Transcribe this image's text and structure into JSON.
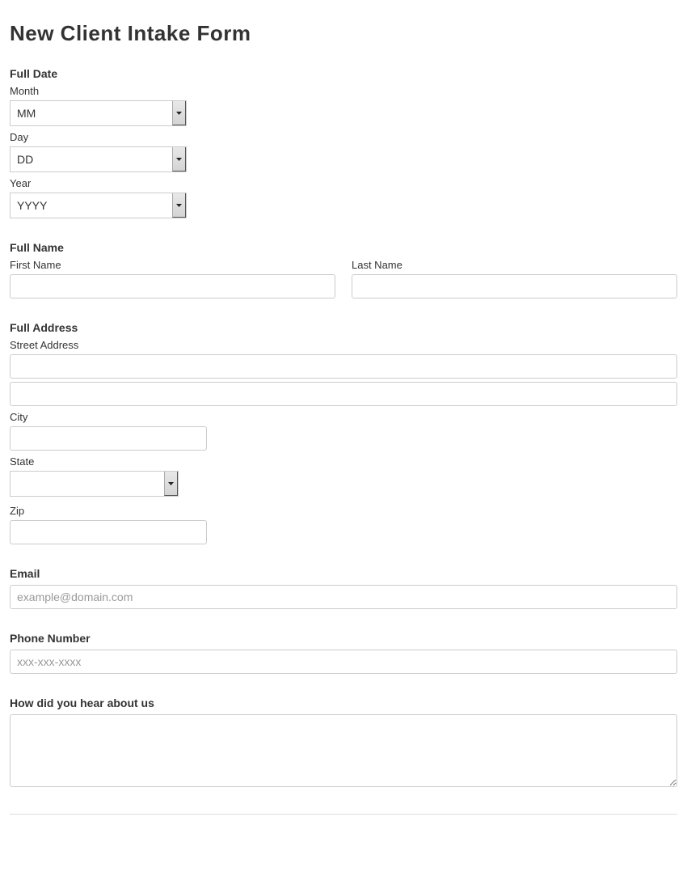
{
  "title": "New Client Intake Form",
  "date": {
    "section_label": "Full Date",
    "month_label": "Month",
    "month_value": "MM",
    "day_label": "Day",
    "day_value": "DD",
    "year_label": "Year",
    "year_value": "YYYY"
  },
  "name": {
    "section_label": "Full Name",
    "first_label": "First Name",
    "last_label": "Last Name"
  },
  "address": {
    "section_label": "Full Address",
    "street_label": "Street Address",
    "city_label": "City",
    "state_label": "State",
    "zip_label": "Zip"
  },
  "email": {
    "section_label": "Email",
    "placeholder": "example@domain.com"
  },
  "phone": {
    "section_label": "Phone Number",
    "placeholder": "xxx-xxx-xxxx"
  },
  "hear": {
    "section_label": "How did you hear about us"
  }
}
